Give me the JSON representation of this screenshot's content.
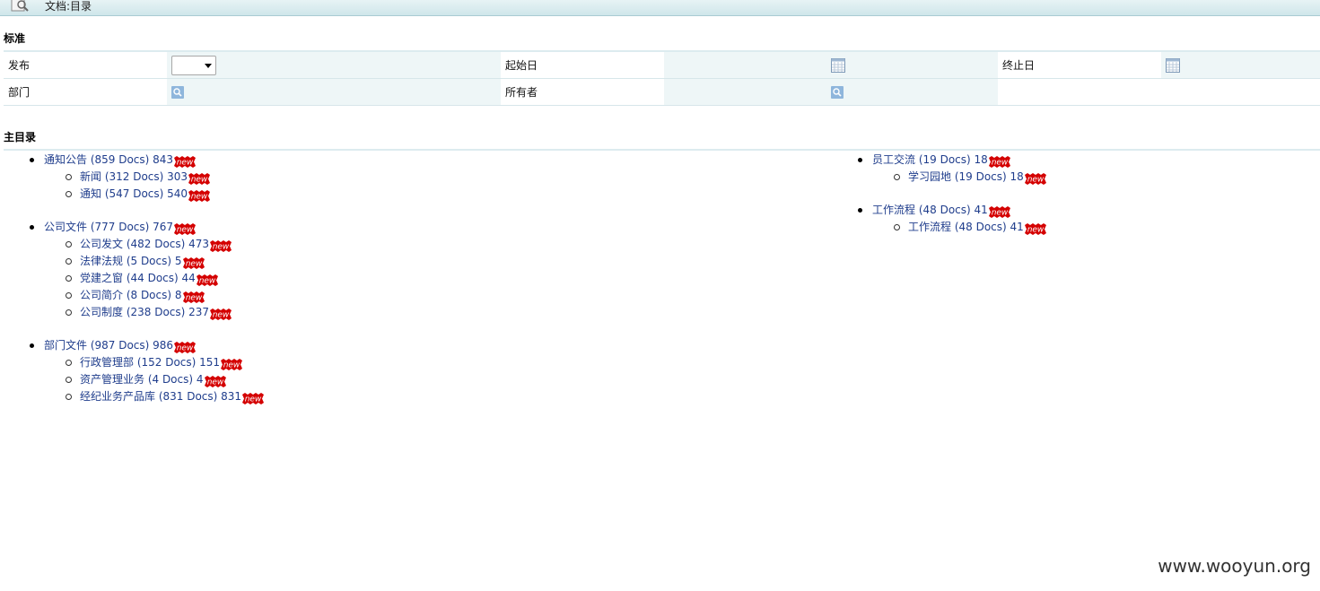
{
  "window": {
    "title": "文档:目录"
  },
  "standard": {
    "title": "标准",
    "fields": {
      "publish_label": "发布",
      "start_label": "起始日",
      "end_label": "终止日",
      "dept_label": "部门",
      "owner_label": "所有者"
    }
  },
  "main": {
    "title": "主目录",
    "badge_text": "new",
    "left": [
      {
        "label": "通知公告 (859 Docs) 843",
        "children": [
          "新闻 (312 Docs) 303",
          "通知 (547 Docs) 540"
        ]
      },
      {
        "label": "公司文件 (777 Docs) 767",
        "children": [
          "公司发文 (482 Docs) 473",
          "法律法规 (5 Docs) 5",
          "党建之窗 (44 Docs) 44",
          "公司简介 (8 Docs) 8",
          "公司制度 (238 Docs) 237"
        ]
      },
      {
        "label": "部门文件 (987 Docs) 986",
        "children": [
          "行政管理部 (152 Docs) 151",
          "资产管理业务 (4 Docs) 4",
          "经纪业务产品库 (831 Docs) 831"
        ]
      }
    ],
    "right": [
      {
        "label": "员工交流 (19 Docs) 18",
        "children": [
          "学习园地 (19 Docs) 18"
        ]
      },
      {
        "label": "工作流程 (48 Docs) 41",
        "children": [
          "工作流程 (48 Docs) 41"
        ]
      }
    ]
  },
  "watermark": "www.wooyun.org",
  "colors": {
    "link": "#1f3d8c",
    "badge": "#d40000",
    "header_bg": "#cfe6ea"
  }
}
